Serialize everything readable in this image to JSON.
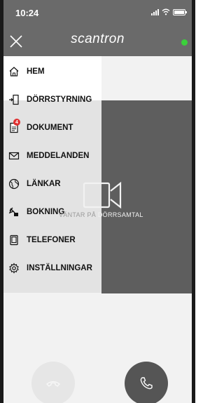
{
  "status_bar": {
    "time": "10:24"
  },
  "header": {
    "brand": "scantron",
    "connection_color": "#3bd13b"
  },
  "menu": {
    "items": [
      {
        "label": "HEM",
        "icon": "home-icon"
      },
      {
        "label": "DÖRRSTYRNING",
        "icon": "door-icon"
      },
      {
        "label": "DOKUMENT",
        "icon": "document-icon",
        "badge": "4"
      },
      {
        "label": "MEDDELANDEN",
        "icon": "envelope-icon"
      },
      {
        "label": "LÄNKAR",
        "icon": "globe-icon"
      },
      {
        "label": "BOKNING",
        "icon": "booking-icon"
      },
      {
        "label": "TELEFONER",
        "icon": "phone-device-icon"
      },
      {
        "label": "INSTÄLLNINGAR",
        "icon": "gear-icon"
      }
    ]
  },
  "video": {
    "waiting_text_dim": "VÄNTAR PÅ ",
    "waiting_text": "DÖRRSAMTAL"
  },
  "colors": {
    "header_bg": "#6a6a6a",
    "video_bg": "#5e5e5e",
    "answer_button": "#555555",
    "end_button": "#e6e6e6"
  }
}
